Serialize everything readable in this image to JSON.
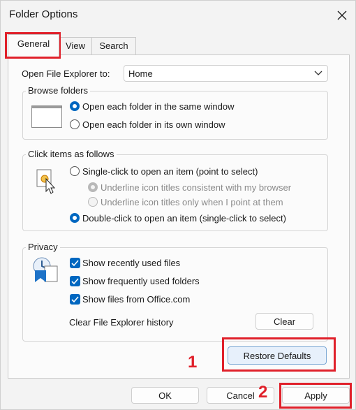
{
  "window": {
    "title": "Folder Options"
  },
  "tabs": [
    {
      "label": "General"
    },
    {
      "label": "View"
    },
    {
      "label": "Search"
    }
  ],
  "open_explorer": {
    "label": "Open File Explorer to:",
    "value": "Home"
  },
  "browse_folders": {
    "legend": "Browse folders",
    "options": [
      {
        "label": "Open each folder in the same window",
        "selected": true
      },
      {
        "label": "Open each folder in its own window",
        "selected": false
      }
    ]
  },
  "click_items": {
    "legend": "Click items as follows",
    "single_click": "Single-click to open an item (point to select)",
    "underline_browser": "Underline icon titles consistent with my browser",
    "underline_point": "Underline icon titles only when I point at them",
    "double_click": "Double-click to open an item (single-click to select)"
  },
  "privacy": {
    "legend": "Privacy",
    "checks": [
      {
        "label": "Show recently used files",
        "checked": true
      },
      {
        "label": "Show frequently used folders",
        "checked": true
      },
      {
        "label": "Show files from Office.com",
        "checked": true
      }
    ],
    "clear_history_label": "Clear File Explorer history",
    "clear_button": "Clear"
  },
  "restore_defaults": "Restore Defaults",
  "footer": {
    "ok": "OK",
    "cancel": "Cancel",
    "apply": "Apply"
  },
  "annotations": {
    "marker1": "1",
    "marker2": "2",
    "color": "#e0202a"
  },
  "icons": [
    "close-icon",
    "window-preview-icon",
    "click-cursor-icon",
    "privacy-icon",
    "chevron-down-icon",
    "checkmark-icon"
  ]
}
